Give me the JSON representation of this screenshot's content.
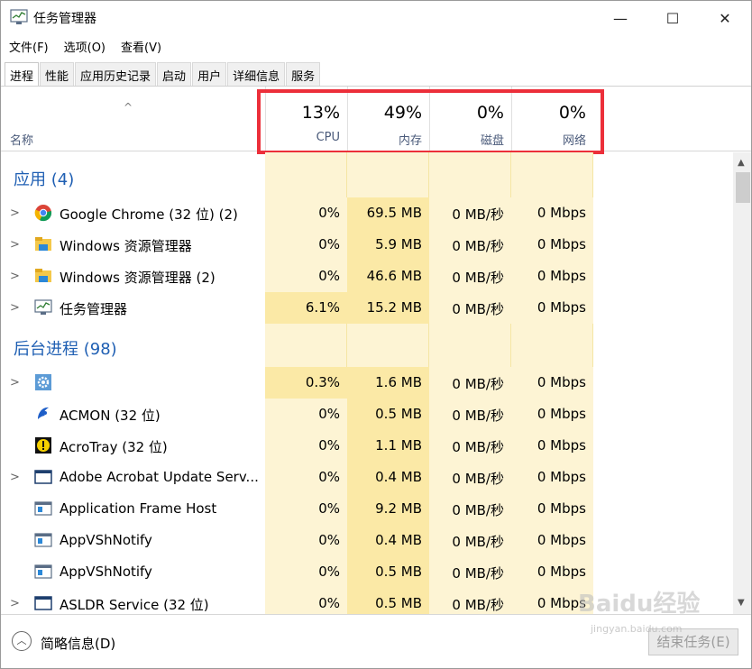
{
  "window": {
    "title": "任务管理器"
  },
  "controls": {
    "minimize": "—",
    "maximize": "☐",
    "close": "✕"
  },
  "menu": [
    "文件(F)",
    "选项(O)",
    "查看(V)"
  ],
  "tabs": [
    "进程",
    "性能",
    "应用历史记录",
    "启动",
    "用户",
    "详细信息",
    "服务"
  ],
  "header": {
    "name": "名称",
    "sort_arrow": "^",
    "columns": [
      {
        "pct": "13%",
        "label": "CPU"
      },
      {
        "pct": "49%",
        "label": "内存"
      },
      {
        "pct": "0%",
        "label": "磁盘"
      },
      {
        "pct": "0%",
        "label": "网络"
      }
    ]
  },
  "groups": {
    "apps": "应用 (4)",
    "background": "后台进程 (98)"
  },
  "apps": [
    {
      "name": "Google Chrome (32 位) (2)",
      "icon": "chrome-icon",
      "expand": true,
      "cpu": "0%",
      "mem": "69.5 MB",
      "disk": "0 MB/秒",
      "net": "0 Mbps"
    },
    {
      "name": "Windows 资源管理器",
      "icon": "folder-icon",
      "expand": true,
      "cpu": "0%",
      "mem": "5.9 MB",
      "disk": "0 MB/秒",
      "net": "0 Mbps"
    },
    {
      "name": "Windows 资源管理器 (2)",
      "icon": "folder-icon",
      "expand": true,
      "cpu": "0%",
      "mem": "46.6 MB",
      "disk": "0 MB/秒",
      "net": "0 Mbps"
    },
    {
      "name": "任务管理器",
      "icon": "task-manager-icon",
      "expand": true,
      "cpu": "6.1%",
      "mem": "15.2 MB",
      "disk": "0 MB/秒",
      "net": "0 Mbps"
    }
  ],
  "background": [
    {
      "name": "",
      "icon": "gear-icon",
      "expand": true,
      "cpu": "0.3%",
      "mem": "1.6 MB",
      "disk": "0 MB/秒",
      "net": "0 Mbps"
    },
    {
      "name": "ACMON (32 位)",
      "icon": "acmon-icon",
      "expand": false,
      "cpu": "0%",
      "mem": "0.5 MB",
      "disk": "0 MB/秒",
      "net": "0 Mbps"
    },
    {
      "name": "AcroTray (32 位)",
      "icon": "acrotray-icon",
      "expand": false,
      "cpu": "0%",
      "mem": "1.1 MB",
      "disk": "0 MB/秒",
      "net": "0 Mbps"
    },
    {
      "name": "Adobe Acrobat Update Serv...",
      "icon": "window-icon",
      "expand": true,
      "cpu": "0%",
      "mem": "0.4 MB",
      "disk": "0 MB/秒",
      "net": "0 Mbps"
    },
    {
      "name": "Application Frame Host",
      "icon": "app-frame-icon",
      "expand": false,
      "cpu": "0%",
      "mem": "9.2 MB",
      "disk": "0 MB/秒",
      "net": "0 Mbps"
    },
    {
      "name": "AppVShNotify",
      "icon": "app-frame-icon",
      "expand": false,
      "cpu": "0%",
      "mem": "0.4 MB",
      "disk": "0 MB/秒",
      "net": "0 Mbps"
    },
    {
      "name": "AppVShNotify",
      "icon": "app-frame-icon",
      "expand": false,
      "cpu": "0%",
      "mem": "0.5 MB",
      "disk": "0 MB/秒",
      "net": "0 Mbps"
    },
    {
      "name": "ASLDR Service (32 位)",
      "icon": "window-icon",
      "expand": true,
      "cpu": "0%",
      "mem": "0.5 MB",
      "disk": "0 MB/秒",
      "net": "0 Mbps"
    }
  ],
  "footer": {
    "brief": "简略信息(D)",
    "end_task": "结束任务(E)"
  },
  "watermark": {
    "main": "Baidu经验",
    "sub": "jingyan.baidu.com"
  },
  "colors": {
    "accent": "#1f5fb3",
    "highlight_box": "#ec2f3a",
    "cell_light": "#fdf4d4",
    "cell_mid": "#fbe9a6"
  }
}
